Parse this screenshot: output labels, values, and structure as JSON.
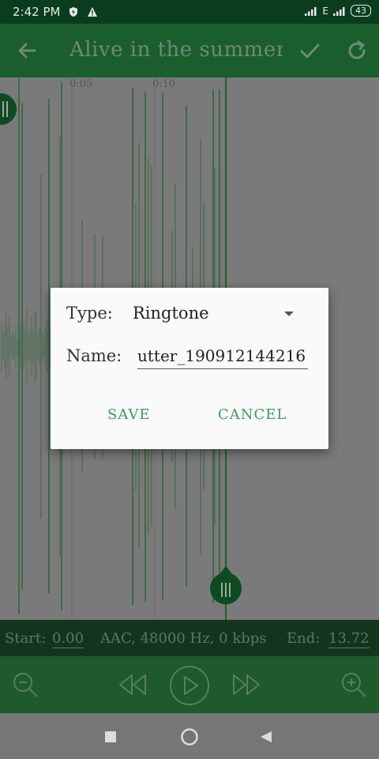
{
  "status_bar": {
    "time": "2:42 PM",
    "network": "E",
    "battery": "43"
  },
  "app_bar": {
    "title": "Alive in the summer…"
  },
  "waveform": {
    "ticks": [
      "0:05",
      "0:10"
    ]
  },
  "info_bar": {
    "start_label": "Start:",
    "start_value": "0.00",
    "format": "AAC, 48000 Hz, 0 kbps",
    "end_label": "End:",
    "end_value": "13.72"
  },
  "dialog": {
    "type_label": "Type:",
    "type_value": "Ringtone",
    "name_label": "Name:",
    "name_value": "utter_190912144216",
    "save_label": "SAVE",
    "cancel_label": "CANCEL"
  },
  "colors": {
    "accent": "#3c9a63",
    "appbar": "#1b5e2e",
    "waveform": "#1f5f2c",
    "marker": "#0e4a22"
  }
}
